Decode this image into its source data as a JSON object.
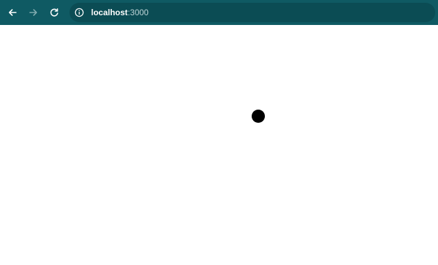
{
  "browser": {
    "toolbar_color": "#0f5a63",
    "address_bar_color": "#0b4c54",
    "nav": [
      {
        "icon": "back-arrow-icon",
        "enabled": true
      },
      {
        "icon": "forward-arrow-icon",
        "enabled": false
      },
      {
        "icon": "reload-icon",
        "enabled": true
      }
    ],
    "address": {
      "site_icon": "info-icon",
      "host": "localhost",
      "port": ":3000"
    }
  },
  "page": {
    "background": "#ffffff",
    "dot": {
      "shape": "circle",
      "color": "#000000"
    }
  }
}
